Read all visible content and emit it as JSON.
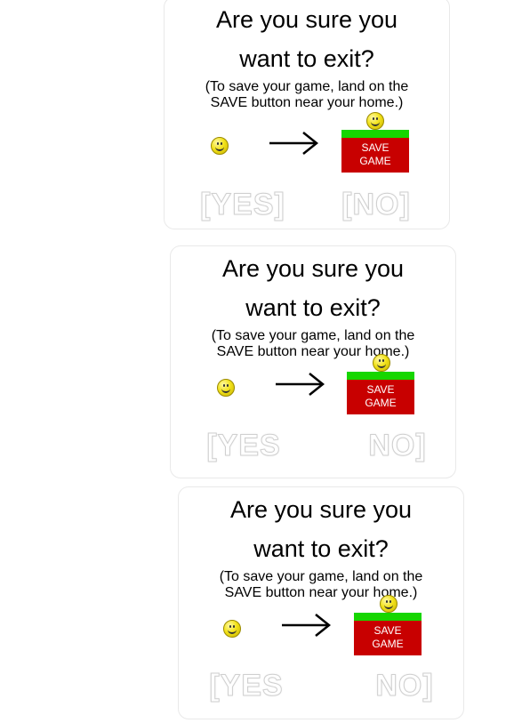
{
  "dialogs": [
    {
      "title_line1": "Are you sure you",
      "title_line2": "want to exit?",
      "subtitle_line1": "(To save your game, land on the",
      "subtitle_line2": "SAVE button near your home.)",
      "save_button_line1": "SAVE",
      "save_button_line2": "GAME",
      "yes_label": "[YES]",
      "no_label": "[NO]"
    },
    {
      "title_line1": "Are you sure you",
      "title_line2": "want to exit?",
      "subtitle_line1": "(To save your game, land on the",
      "subtitle_line2": "SAVE button near your home.)",
      "save_button_line1": "SAVE",
      "save_button_line2": "GAME",
      "yes_label": "[YES",
      "no_label": "NO]"
    },
    {
      "title_line1": "Are you sure you",
      "title_line2": "want to exit?",
      "subtitle_line1": "(To save your game, land on the",
      "subtitle_line2": "SAVE button near your home.)",
      "save_button_line1": "SAVE",
      "save_button_line2": "GAME",
      "yes_label": "[YES",
      "no_label": "NO]"
    }
  ],
  "colors": {
    "save_green": "#16d600",
    "save_red": "#c80000",
    "smiley_yellow": "#f2e21a"
  },
  "icons": {
    "smiley": "smiley-face-icon",
    "arrow": "right-arrow-icon"
  }
}
